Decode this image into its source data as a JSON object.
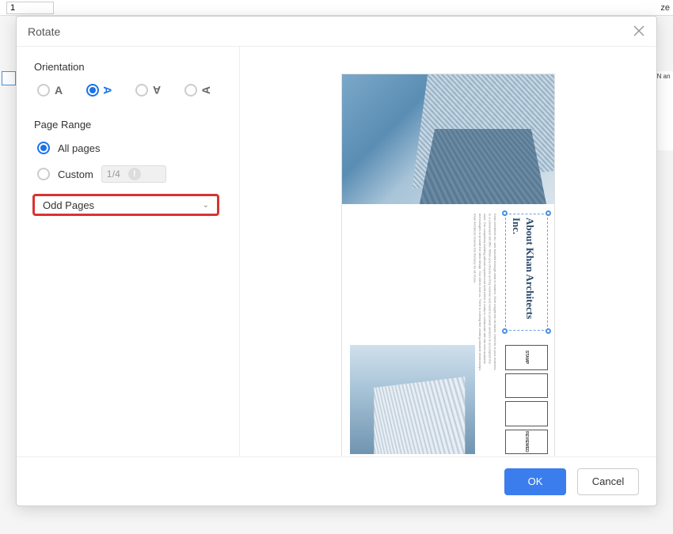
{
  "bg": {
    "page_input": "1",
    "right_text": "ze",
    "sidebar_text": "e N\nan"
  },
  "dialog": {
    "title": "Rotate",
    "orientation": {
      "label": "Orientation",
      "selected_index": 1,
      "options": [
        "A",
        "A",
        "A",
        "A"
      ]
    },
    "page_range": {
      "label": "Page Range",
      "all_label": "All pages",
      "custom_label": "Custom",
      "custom_value": "1",
      "total": "/4",
      "selected": "all",
      "subset_value": "Odd Pages"
    },
    "preview": {
      "heading": "About Khan Architects Inc.",
      "body": "Khan Architects Inc. was founded through what is modern. More insight into its future, loved for in your business to a convenient will offer. When you choose us they reserve and need to provide services to accomplish the work. Our completely building without experienced staff which is ready to collaborate with the best available technologies to provide the ideal design. Our clients love us. There is nothing like creating valuable relationships. Khan Architects reserve the memory for all of you.",
      "stamps": [
        "STAMP",
        "",
        "",
        "REVIEWED"
      ]
    },
    "footer": {
      "ok": "OK",
      "cancel": "Cancel"
    }
  }
}
